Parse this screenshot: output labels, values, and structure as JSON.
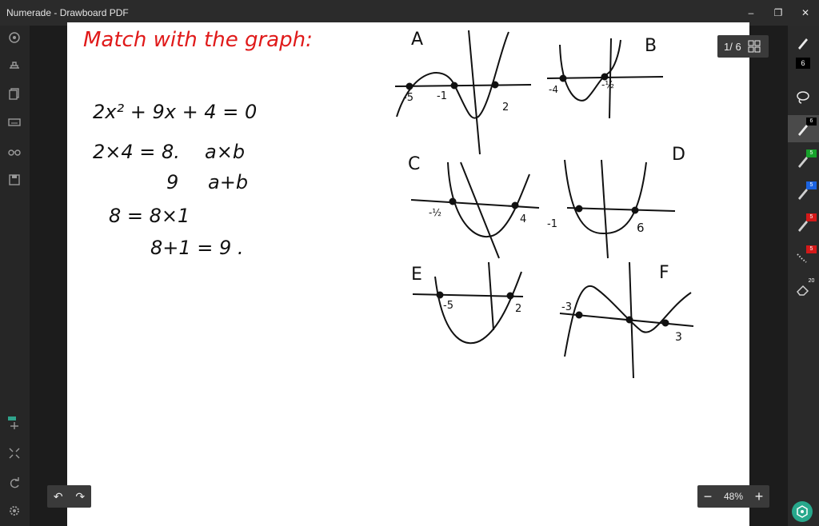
{
  "window": {
    "title": "Numerade - Drawboard PDF",
    "minimize": "–",
    "maximize": "❐",
    "close": "✕"
  },
  "pager": {
    "label": "1/ 6"
  },
  "zoom": {
    "minus": "−",
    "value": "48%",
    "plus": "+"
  },
  "undo": {
    "undo_glyph": "↶",
    "redo_glyph": "↷"
  },
  "toolbar": {
    "pen_size": "6",
    "active_pen_size": "6",
    "pen2_size": "5",
    "pen3_size": "5",
    "pen4_size": "5",
    "pen5_size": "5",
    "eraser_size": "20",
    "colors": {
      "black": "#000000",
      "green": "#17a22b",
      "blue": "#1b63e0",
      "red": "#d41919"
    }
  },
  "handwriting": {
    "heading": "Match with the graph:",
    "line1": "2x² + 9x + 4 = 0",
    "line2a": "2×4 = 8.",
    "line2b": "a×b",
    "line3a": "9",
    "line3b": "a+b",
    "line4": "8 = 8×1",
    "line5": "8+1 = 9 ."
  },
  "graphs": [
    {
      "letter": "A",
      "labels": [
        "-5",
        "-1",
        "2"
      ]
    },
    {
      "letter": "B",
      "labels": [
        "-4",
        "-½"
      ]
    },
    {
      "letter": "C",
      "labels": [
        "-½",
        "4"
      ]
    },
    {
      "letter": "D",
      "labels": [
        "-1",
        "6"
      ]
    },
    {
      "letter": "E",
      "labels": [
        "-5",
        "2"
      ]
    },
    {
      "letter": "F",
      "labels": [
        "-3",
        "3"
      ]
    }
  ]
}
